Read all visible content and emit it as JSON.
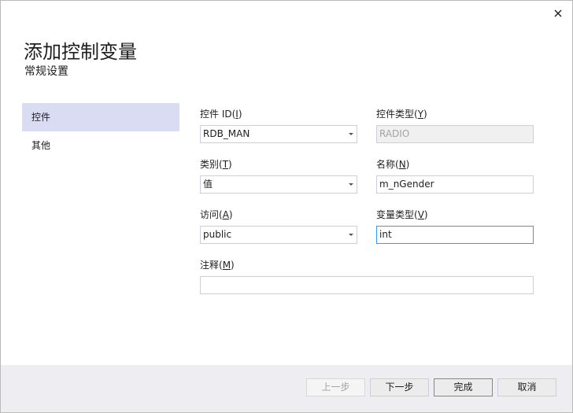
{
  "dialog": {
    "title": "添加控制变量",
    "subtitle": "常规设置",
    "close_icon": "close-icon"
  },
  "nav": {
    "items": [
      {
        "label": "控件",
        "selected": true
      },
      {
        "label": "其他",
        "selected": false
      }
    ]
  },
  "form": {
    "control_id": {
      "label_prefix": "控件 ID(",
      "label_key": "I",
      "label_suffix": ")",
      "value": "RDB_MAN"
    },
    "control_type": {
      "label_prefix": "控件类型(",
      "label_key": "Y",
      "label_suffix": ")",
      "value": "RADIO"
    },
    "category": {
      "label_prefix": "类别(",
      "label_key": "T",
      "label_suffix": ")",
      "value": "值"
    },
    "name": {
      "label_prefix": "名称(",
      "label_key": "N",
      "label_suffix": ")",
      "value": "m_nGender"
    },
    "access": {
      "label_prefix": "访问(",
      "label_key": "A",
      "label_suffix": ")",
      "value": "public"
    },
    "variable_type": {
      "label_prefix": "变量类型(",
      "label_key": "V",
      "label_suffix": ")",
      "value": "int"
    },
    "comment": {
      "label_prefix": "注释(",
      "label_key": "M",
      "label_suffix": ")",
      "value": ""
    }
  },
  "footer": {
    "prev_label": "上一步",
    "next_label": "下一步",
    "finish_label": "完成",
    "cancel_label": "取消"
  },
  "colors": {
    "nav_selected": "#dadcf4",
    "focus_border": "#3399ff",
    "footer_bg": "#eeeef2"
  }
}
